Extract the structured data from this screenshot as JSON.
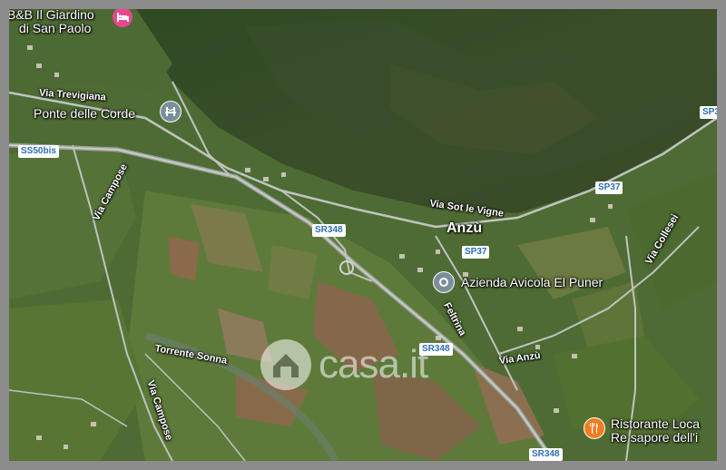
{
  "map": {
    "places": {
      "bnb_line1": "B&B Il Giardino",
      "bnb_line2": "di San Paolo",
      "ponte": "Ponte delle Corde",
      "anzu": "Anzù",
      "azienda": "Azienda Avicola El Puner",
      "ristorante_line1": "Ristorante Loca",
      "ristorante_line2": "Re sapore dell'i"
    },
    "roads": {
      "via_trevigiana": "Via Trevigiana",
      "via_campose_1": "Via Campose",
      "via_campose_2": "Via Campose",
      "via_sot_le_vigne": "Via Sot le Vigne",
      "via_collesei": "Via Collesei",
      "feltrina": "Feltrina",
      "via_anzu": "Via Anzù",
      "torrente_sonna": "Torrente Sonna"
    },
    "shields": {
      "ss50bis": "SS50bis",
      "sr348_a": "SR348",
      "sp37_a": "SP37",
      "sp37_b": "SP37",
      "sp37_c": "SP3",
      "sr348_b": "SR348",
      "sr348_c": "SR348"
    },
    "icons": {
      "hotel": "hotel-icon",
      "bridge": "bridge-icon",
      "place": "place-pin-icon",
      "restaurant": "restaurant-icon"
    },
    "colors": {
      "hotel_pin": "#e8478f",
      "bridge_pin": "#7a8f9a",
      "place_pin": "#7d8e9b",
      "restaurant_pin": "#ef7d22",
      "road_shield_text": "#2b6fb6"
    },
    "watermark": "casa.it"
  }
}
